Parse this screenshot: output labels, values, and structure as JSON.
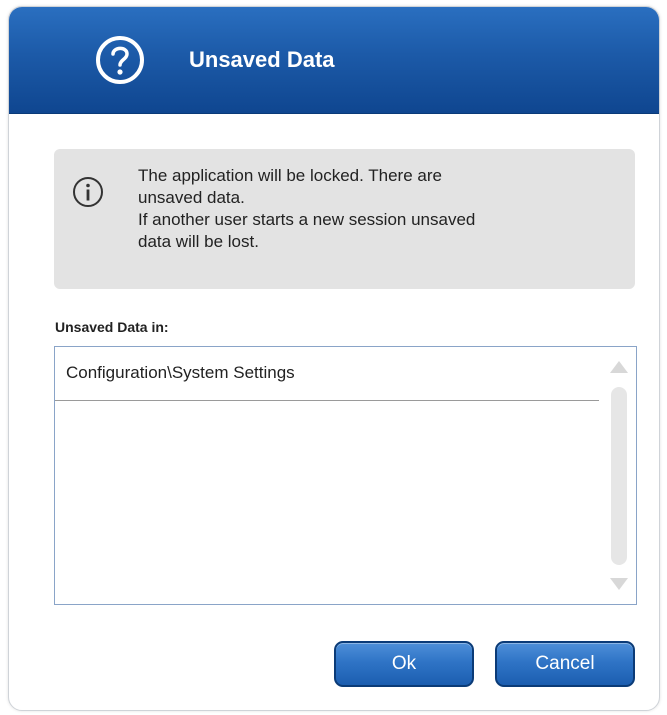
{
  "dialog": {
    "title": "Unsaved Data",
    "title_icon": "question-circle-icon",
    "header_color": "#1c5aa8"
  },
  "info": {
    "icon": "info-circle-icon",
    "line1": "The application will be locked. There are",
    "line2": "unsaved data.",
    "line3": "If another user starts a new session unsaved",
    "line4": "data will be lost."
  },
  "list": {
    "label": "Unsaved Data in:",
    "items": [
      {
        "label": "Configuration\\System Settings"
      }
    ]
  },
  "buttons": {
    "ok_label": "Ok",
    "cancel_label": "Cancel",
    "color": "#2f74c6"
  }
}
